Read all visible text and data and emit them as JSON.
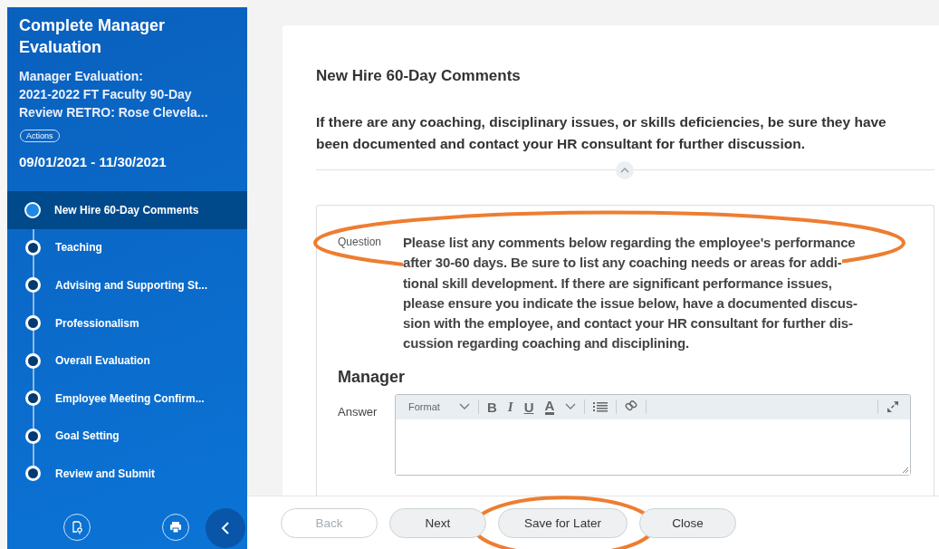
{
  "sidebar": {
    "title": "Complete Manager Evaluation",
    "subtitle_lines": [
      "Manager Evaluation:",
      "2021-2022 FT Faculty 90-Day",
      "Review RETRO: Rose Clevela..."
    ],
    "actions_label": "Actions",
    "dates": "09/01/2021 - 11/30/2021",
    "steps": [
      {
        "label": "New Hire 60-Day Comments",
        "selected": true
      },
      {
        "label": "Teaching",
        "selected": false
      },
      {
        "label": "Advising and Supporting St...",
        "selected": false
      },
      {
        "label": "Professionalism",
        "selected": false
      },
      {
        "label": "Overall Evaluation",
        "selected": false
      },
      {
        "label": "Employee Meeting Confirm...",
        "selected": false
      },
      {
        "label": "Goal Setting",
        "selected": false
      },
      {
        "label": "Review and Submit",
        "selected": false
      }
    ]
  },
  "card": {
    "heading": "New Hire 60-Day Comments",
    "instructions": "If there are any coaching, disciplinary issues, or skills deficiencies, be sure they have been documented and contact your HR consultant for further discussion.",
    "question": {
      "label": "Question",
      "highlighted": true,
      "text_lines": [
        "Please list any comments below regarding the employee's performance",
        "after 30-60 days. Be sure to list any coaching needs or areas for addi-",
        "tional skill development. If there are significant performance issues,",
        "please ensure you indicate the issue below, have a documented discus-",
        "sion with the employee, and contact your HR consultant for further dis-",
        "cussion regarding coaching and disciplining."
      ]
    },
    "section": "Manager",
    "answer": {
      "label": "Answer",
      "toolbar": [
        {
          "kind": "dropdown",
          "text": "Format"
        },
        {
          "kind": "bold",
          "text": "B"
        },
        {
          "kind": "italic",
          "text": "I"
        },
        {
          "kind": "underline",
          "text": "U"
        },
        {
          "kind": "color",
          "text": "A"
        },
        {
          "kind": "list"
        },
        {
          "kind": "link"
        },
        {
          "kind": "expand"
        }
      ]
    }
  },
  "buttons": [
    {
      "label": "Back",
      "disabled": true,
      "highlighted": false
    },
    {
      "label": "Next",
      "disabled": false,
      "highlighted": false
    },
    {
      "label": "Save for Later",
      "disabled": false,
      "highlighted": true
    },
    {
      "label": "Close",
      "disabled": false,
      "highlighted": false
    }
  ]
}
